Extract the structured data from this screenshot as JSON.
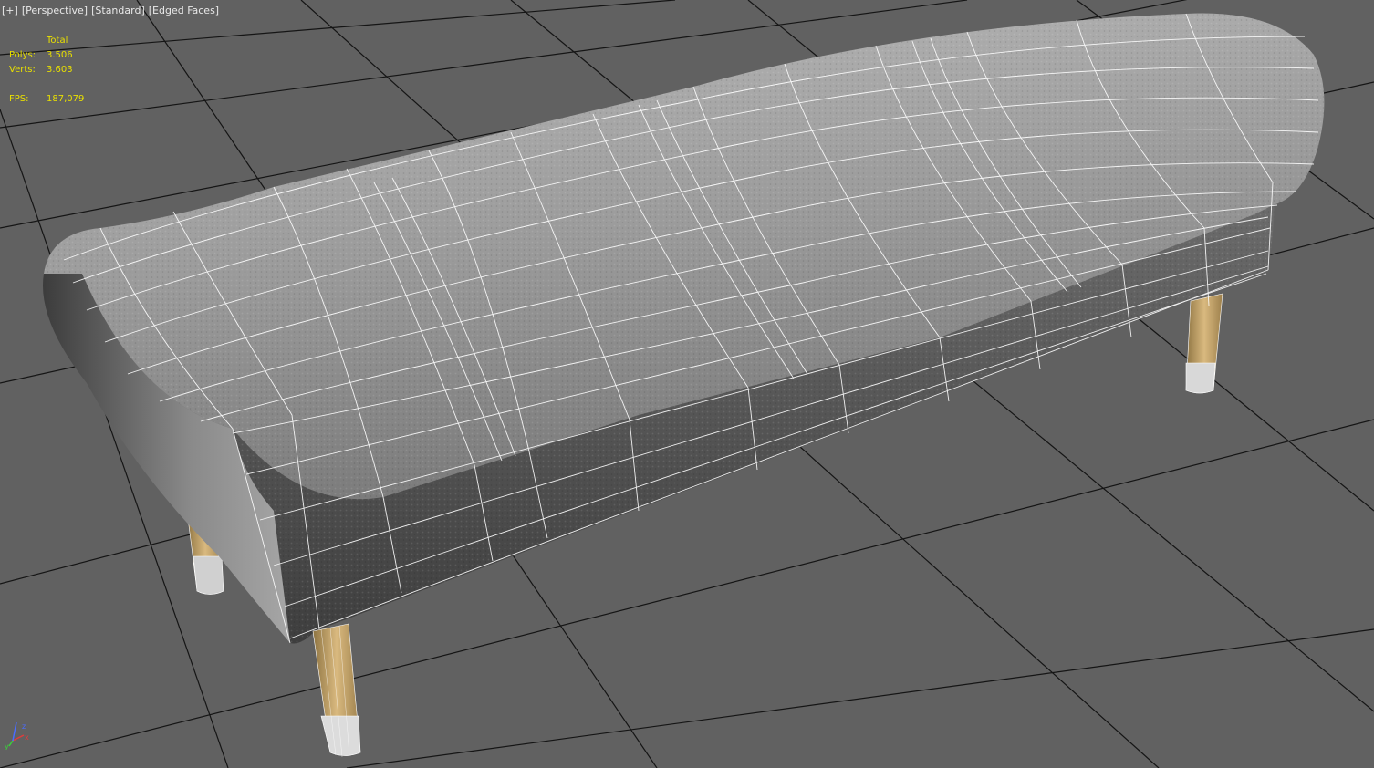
{
  "viewport": {
    "labels": {
      "plus_menu": "[+]",
      "view_menu": "[Perspective]",
      "shading_menu": "[Standard]",
      "display_menu": "[Edged Faces]"
    },
    "stats": {
      "header": "Total",
      "polys_label": "Polys:",
      "polys_value": "3.506",
      "verts_label": "Verts:",
      "verts_value": "3.603",
      "fps_label": "FPS:",
      "fps_value": "187,079"
    },
    "axes": {
      "x": "x",
      "y": "y",
      "z": "z"
    },
    "colors": {
      "background": "#616161",
      "grid": "#151515",
      "stats_text": "#e9e000",
      "wire": "#ffffff",
      "leather": "#8d8d8d",
      "wood": "#c9a56a"
    },
    "scene": {
      "object": "upholstered-bench",
      "cushion_segments": 6,
      "legs": 4
    }
  }
}
